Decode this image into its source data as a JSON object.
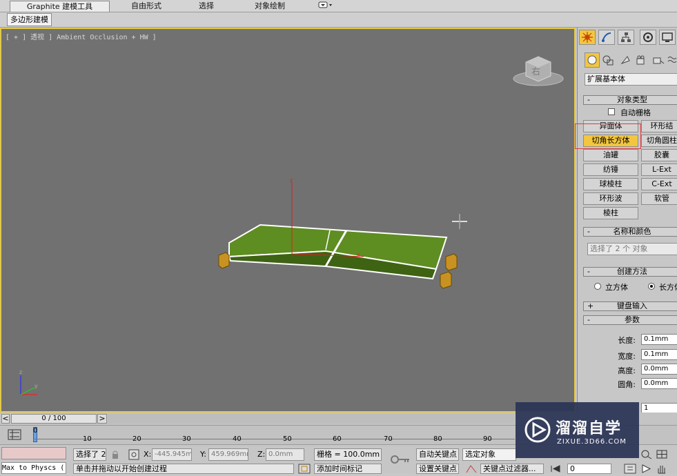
{
  "ribbon": {
    "tabs": [
      "Graphite 建模工具",
      "自由形式",
      "选择",
      "对象绘制"
    ],
    "subtab": "多边形建模"
  },
  "viewport": {
    "label": "[ + ] 透视 ] Ambient Occlusion + HW ]",
    "viewcube_face": "右"
  },
  "command_panel": {
    "category": "扩展基本体",
    "object_type": {
      "header": "对象类型",
      "autogrid": "自动栅格",
      "buttons": [
        "异面体",
        "环形结",
        "切角长方体",
        "切角圆柱",
        "油罐",
        "胶囊",
        "纺锤",
        "L-Ext",
        "球棱柱",
        "C-Ext",
        "环形波",
        "软管",
        "棱柱"
      ],
      "active": "切角长方体"
    },
    "name_color": {
      "header": "名称和颜色",
      "value": "选择了 2 个 对象"
    },
    "creation_method": {
      "header": "创建方法",
      "options": [
        "立方体",
        "长方体"
      ],
      "selected": "长方体"
    },
    "keyboard_entry": {
      "header": "键盘输入"
    },
    "parameters": {
      "header": "参数",
      "fields": [
        {
          "label": "长度:",
          "value": "0.1mm"
        },
        {
          "label": "宽度:",
          "value": "0.1mm"
        },
        {
          "label": "高度:",
          "value": "0.0mm"
        },
        {
          "label": "圆角:",
          "value": "0.0mm"
        }
      ],
      "segments": [
        "1",
        "1",
        "1"
      ]
    }
  },
  "timeline": {
    "frame": "0 / 100",
    "prev": "<",
    "next": ">",
    "ticks": [
      "0",
      "10",
      "20",
      "30",
      "40",
      "50",
      "60",
      "70",
      "80",
      "90"
    ]
  },
  "status": {
    "maxscript": "Max to Physcs (",
    "selected": "选择了 2",
    "prompt": "单击并拖动以开始创建过程",
    "x_label": "X:",
    "x_value": "-445.945m",
    "y_label": "Y:",
    "y_value": "459.969mm",
    "z_label": "Z:",
    "z_value": "0.0mm",
    "grid": "栅格 = 100.0mm",
    "add_tag": "添加时间标记",
    "autokey": "自动关键点",
    "setkey": "设置关键点",
    "selection_set": "选定对象",
    "key_filters": "关键点过滤器...",
    "frame_field": "0"
  },
  "watermark": {
    "brand": "溜溜自学",
    "url": "ZIXUE.3D66.COM"
  },
  "colors": {
    "viewport_bg": "#717171",
    "active_border": "#e3c94a",
    "object_green": "#4f7a1a",
    "highlight_button": "#f3c63f",
    "annotation_red": "#e03c3c"
  }
}
